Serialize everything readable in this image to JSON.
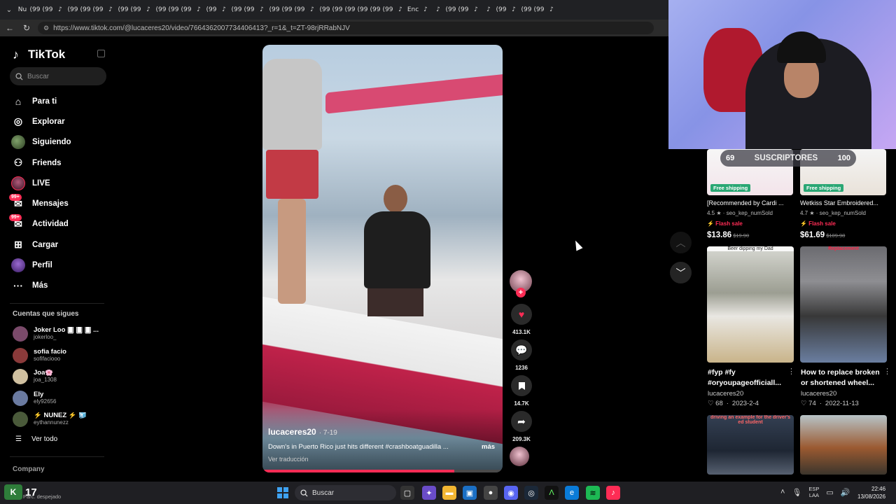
{
  "browser": {
    "url": "https://www.tiktok.com/@lucaceres20/video/7664362007734406413?_r=1&_t=ZT-98rjRRabNJV",
    "mini_tabs": [
      "Nu",
      "(99",
      "(99",
      "♪",
      "(99",
      "(99",
      "(99",
      "♪",
      "(99",
      "(99",
      "♪",
      "(99",
      "(99",
      "(99",
      "♪",
      "(99",
      "♪",
      "(99",
      "(99",
      "♪",
      "(99",
      "(99",
      "(99",
      "♪",
      "(99",
      "(99",
      "(99",
      "(99",
      "(99",
      "(99",
      "♪",
      "Enc",
      "♪",
      "♪",
      "(99",
      "(99",
      "♪",
      "♪",
      "(99",
      "♪",
      "(99",
      "(99",
      "♪"
    ]
  },
  "sidebar": {
    "logo": "TikTok",
    "search_placeholder": "Buscar",
    "nav": [
      {
        "label": "Para ti",
        "icon": "home-icon"
      },
      {
        "label": "Explorar",
        "icon": "compass-icon"
      },
      {
        "label": "Siguiendo",
        "icon": "following-avatar-icon"
      },
      {
        "label": "Friends",
        "icon": "friends-icon"
      },
      {
        "label": "LIVE",
        "icon": "live-icon"
      },
      {
        "label": "Mensajes",
        "icon": "messages-icon",
        "badge": "99+"
      },
      {
        "label": "Actividad",
        "icon": "activity-icon",
        "badge": "99+"
      },
      {
        "label": "Cargar",
        "icon": "upload-icon"
      },
      {
        "label": "Perfil",
        "icon": "profile-avatar-icon"
      },
      {
        "label": "Más",
        "icon": "more-icon"
      }
    ],
    "following_title": "Cuentas que sigues",
    "following": [
      {
        "name": "Joker Loo 🂠 🂠 🂠 ...",
        "handle": "jokerloo_",
        "color": "#7a4a6a"
      },
      {
        "name": "sofia facio",
        "handle": "sofifaciooo",
        "color": "#8a3a3a"
      },
      {
        "name": "Joa🌸",
        "handle": "joa_1308",
        "color": "#d0c0a0"
      },
      {
        "name": "Ely",
        "handle": "ely92656",
        "color": "#6a7aa0"
      },
      {
        "name": "⚡ NÚÑEZ ⚡ 🧊",
        "handle": "eythannunezz",
        "color": "#4a5a3a"
      }
    ],
    "see_all": "Ver todo",
    "company": "Company"
  },
  "video": {
    "author": "lucaceres20",
    "date": "· 7-19",
    "description": "Down's in Puerto Rico just hits different #crashboatguadilla ...",
    "more": "más",
    "translate": "Ver traducción",
    "progress": 0.8
  },
  "actions": {
    "likes": "413.1K",
    "comments": "1236",
    "saves": "14.7K",
    "shares": "209.3K"
  },
  "overlay": {
    "subs_left": "69",
    "subs_label": "SUSCRIPTORES",
    "subs_right": "100"
  },
  "shop": [
    {
      "title": "[Recommended by Cardi ...",
      "rating": "4.5 ★ · seo_kep_numSold",
      "flash": "⚡ Flash sale",
      "price": "$13.86",
      "old": "$19.90",
      "ship": "Free shipping"
    },
    {
      "title": "Wetkiss Star Embroidered...",
      "rating": "4.7 ★ · seo_kep_numSold",
      "flash": "⚡ Flash sale",
      "price": "$61.69",
      "old": "$109.98",
      "ship": "Free shipping"
    }
  ],
  "recs": [
    {
      "caption": "Beer dipping my Dad",
      "title": "#fyp #fy #oryoupageofficiall...",
      "author": "lucaceres20",
      "likes": "♡ 68",
      "date": "2023-2-4"
    },
    {
      "caption": "Replacement",
      "title": "How to replace broken or shortened wheel...",
      "author": "lucaceres20",
      "likes": "♡ 74",
      "date": "2022-11-13"
    },
    {
      "caption": "driving an example for the driver's ed student"
    },
    {
      "caption": ""
    }
  ],
  "taskbar": {
    "temp": "17",
    "weather_badge": "K",
    "condition": "Parc. despejado",
    "search": "Buscar",
    "lang_top": "ESP",
    "lang_bottom": "LAA",
    "time": "22:46",
    "date": "13/08/2026"
  }
}
